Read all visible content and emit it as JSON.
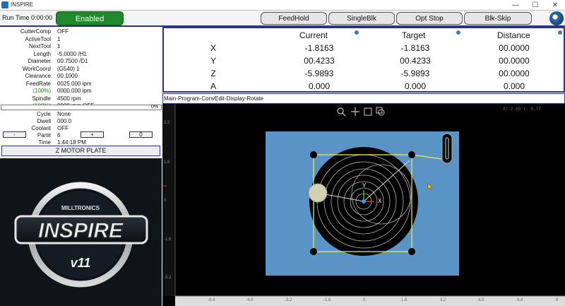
{
  "window": {
    "title": "INSPIRE",
    "controls": [
      "—",
      "☐",
      "✕"
    ]
  },
  "toolbar": {
    "run_time": "Run Time 0:00:00",
    "enabled": "Enabled",
    "buttons": [
      "FeedHold",
      "SingleBlk",
      "Opt Stop",
      "Blk-Skip"
    ]
  },
  "status": {
    "rows": [
      {
        "label": "CutterComp",
        "value": "OFF"
      },
      {
        "label": "ActiveTool",
        "value": "1"
      },
      {
        "label": "NextTool",
        "value": "1"
      },
      {
        "label": "Length",
        "value": "-5.0000 /H1"
      },
      {
        "label": "Diameter",
        "value": "00.7500 /D1"
      },
      {
        "label": "WorkCoord",
        "value": "(G540) 1"
      },
      {
        "label": "Clearance",
        "value": "00.1000"
      },
      {
        "label": "FeedRate",
        "value": "0025.000 ipm"
      },
      {
        "label": "(100%)",
        "value": "0000.000 ipm"
      },
      {
        "label": "Spindle",
        "value": "4500 rpm"
      },
      {
        "label": "(100%)",
        "value": "0000 rpm OFF"
      }
    ],
    "progress_pct": "0%",
    "cycle_rows": [
      {
        "label": "Cycle",
        "value": "None"
      },
      {
        "label": "Dwell",
        "value": "000.0"
      },
      {
        "label": "Coolant",
        "value": "OFF"
      },
      {
        "label": "Part#",
        "value": "6"
      },
      {
        "label": "Time",
        "value": "1:44:18 PM"
      }
    ],
    "part_minus": "-",
    "part_plus": "+",
    "part_reset": "0",
    "zmotor": "Z MOTOR PLATE"
  },
  "brand": {
    "company": "MILLTRONICS",
    "product": "INSPIRE",
    "version": "v11"
  },
  "dro": {
    "headers": [
      "Current",
      "Target",
      "Distance"
    ],
    "rows": [
      {
        "axis": "X",
        "current": "-1.8163",
        "target": "-1.8163",
        "distance": "00.0000"
      },
      {
        "axis": "Y",
        "current": "00.4233",
        "target": "00.4233",
        "distance": "00.0000"
      },
      {
        "axis": "Z",
        "current": "-5.9893",
        "target": "-5.9893",
        "distance": "00.0000"
      },
      {
        "axis": "A",
        "current": "0.000",
        "target": "0.000",
        "distance": "0.000"
      }
    ]
  },
  "program_tabs": "Main-Program-ConvEdit-Display-Rotate",
  "graphics": {
    "cursor_readout": "X:   2.69  Y:   0.77",
    "y_ticks": [
      "3.2",
      "1.6",
      "0",
      "-1.6",
      "-3.2"
    ],
    "x_ticks": [
      "-6.4",
      "-4.8",
      "-3.2",
      "-1.6",
      "0",
      "1.6",
      "3.2",
      "4.8",
      "6.4",
      "8"
    ],
    "axis_x": "X",
    "axis_y": "Y",
    "colors": {
      "plate": "#5a93c6",
      "table": "#000000",
      "boundary": "#e6e94a"
    }
  }
}
